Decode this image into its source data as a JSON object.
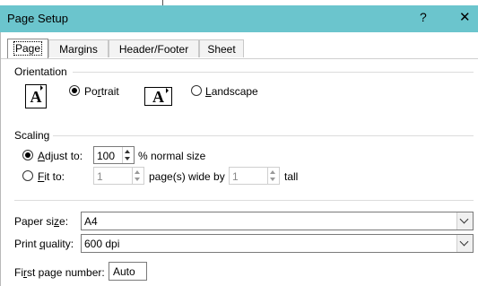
{
  "window": {
    "title": "Page Setup",
    "help_glyph": "?",
    "close_glyph": "✕"
  },
  "tabs": [
    {
      "label": "Page",
      "active": true
    },
    {
      "label": "Margins",
      "active": false
    },
    {
      "label": "Header/Footer",
      "active": false
    },
    {
      "label": "Sheet",
      "active": false
    }
  ],
  "orientation": {
    "heading": "Orientation",
    "icon_letter": "A",
    "portrait_label_pre": "Po",
    "portrait_label_u": "r",
    "portrait_label_post": "trait",
    "landscape_label_u": "L",
    "landscape_label_post": "andscape",
    "selected": "portrait"
  },
  "scaling": {
    "heading": "Scaling",
    "adjust_label_u": "A",
    "adjust_label_post": "djust to:",
    "adjust_value": "100",
    "adjust_suffix": "% normal size",
    "fit_label_u": "F",
    "fit_label_post": "it to:",
    "fit_wide_value": "1",
    "fit_wide_suffix": "page(s) wide by",
    "fit_tall_value": "1",
    "fit_tall_suffix": "tall",
    "selected": "adjust"
  },
  "paper": {
    "paper_size_label_pre": "Paper si",
    "paper_size_label_u": "z",
    "paper_size_label_post": "e:",
    "paper_size_value": "A4",
    "print_quality_label_pre": "Print ",
    "print_quality_label_u": "q",
    "print_quality_label_post": "uality:",
    "print_quality_value": "600 dpi",
    "first_page_label_pre": "Fi",
    "first_page_label_u": "r",
    "first_page_label_post": "st page number:",
    "first_page_value": "Auto"
  }
}
